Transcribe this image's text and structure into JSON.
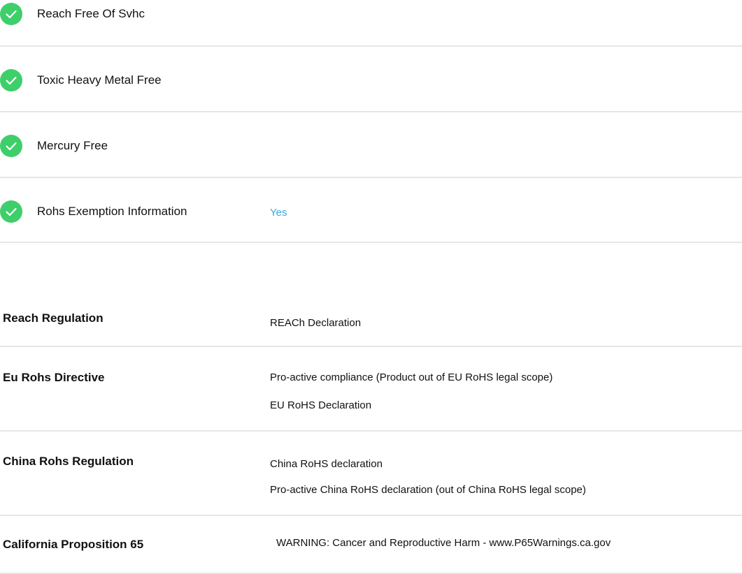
{
  "features": [
    {
      "label": "Reach Free Of Svhc",
      "icon": "check-circle-icon"
    },
    {
      "label": "Toxic Heavy Metal Free",
      "icon": "check-circle-icon"
    },
    {
      "label": "Mercury Free",
      "icon": "check-circle-icon"
    },
    {
      "label": "Rohs Exemption Information",
      "icon": "check-circle-icon",
      "value": "Yes"
    }
  ],
  "regulations": {
    "reach": {
      "label": "Reach Regulation",
      "link": "REACh Declaration"
    },
    "eu_rohs": {
      "label": "Eu Rohs Directive",
      "text": "Pro-active compliance (Product out of EU RoHS legal scope)",
      "link": "EU RoHS Declaration"
    },
    "china_rohs": {
      "label": "China Rohs Regulation",
      "link": "China RoHS declaration",
      "text": "Pro-active China RoHS declaration (out of China RoHS legal scope)"
    },
    "california": {
      "label": "California Proposition 65",
      "text": "WARNING: Cancer and Reproductive Harm - www.P65Warnings.ca.gov"
    }
  },
  "colors": {
    "check_green": "#3ecf6a",
    "link_blue": "#3aa9dc",
    "divider": "#e6e6e6"
  }
}
